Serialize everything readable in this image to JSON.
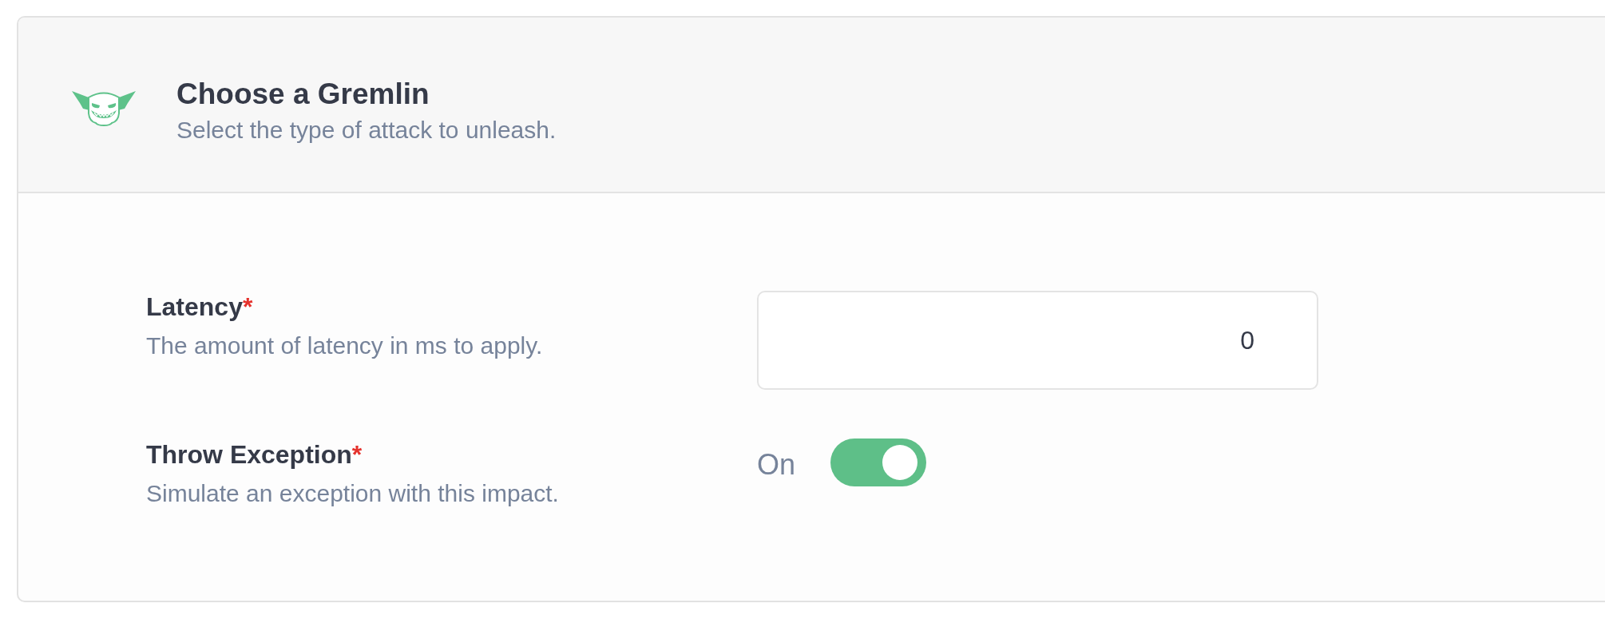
{
  "header": {
    "title": "Choose a Gremlin",
    "subtitle": "Select the type of attack to unleash."
  },
  "fields": [
    {
      "kind": "number",
      "label": "Latency",
      "required_mark": "*",
      "description": "The amount of latency in ms to apply.",
      "value": "0"
    },
    {
      "kind": "toggle",
      "label": "Throw Exception",
      "required_mark": "*",
      "description": "Simulate an exception with this impact.",
      "state_label": "On",
      "on": true
    }
  ]
}
